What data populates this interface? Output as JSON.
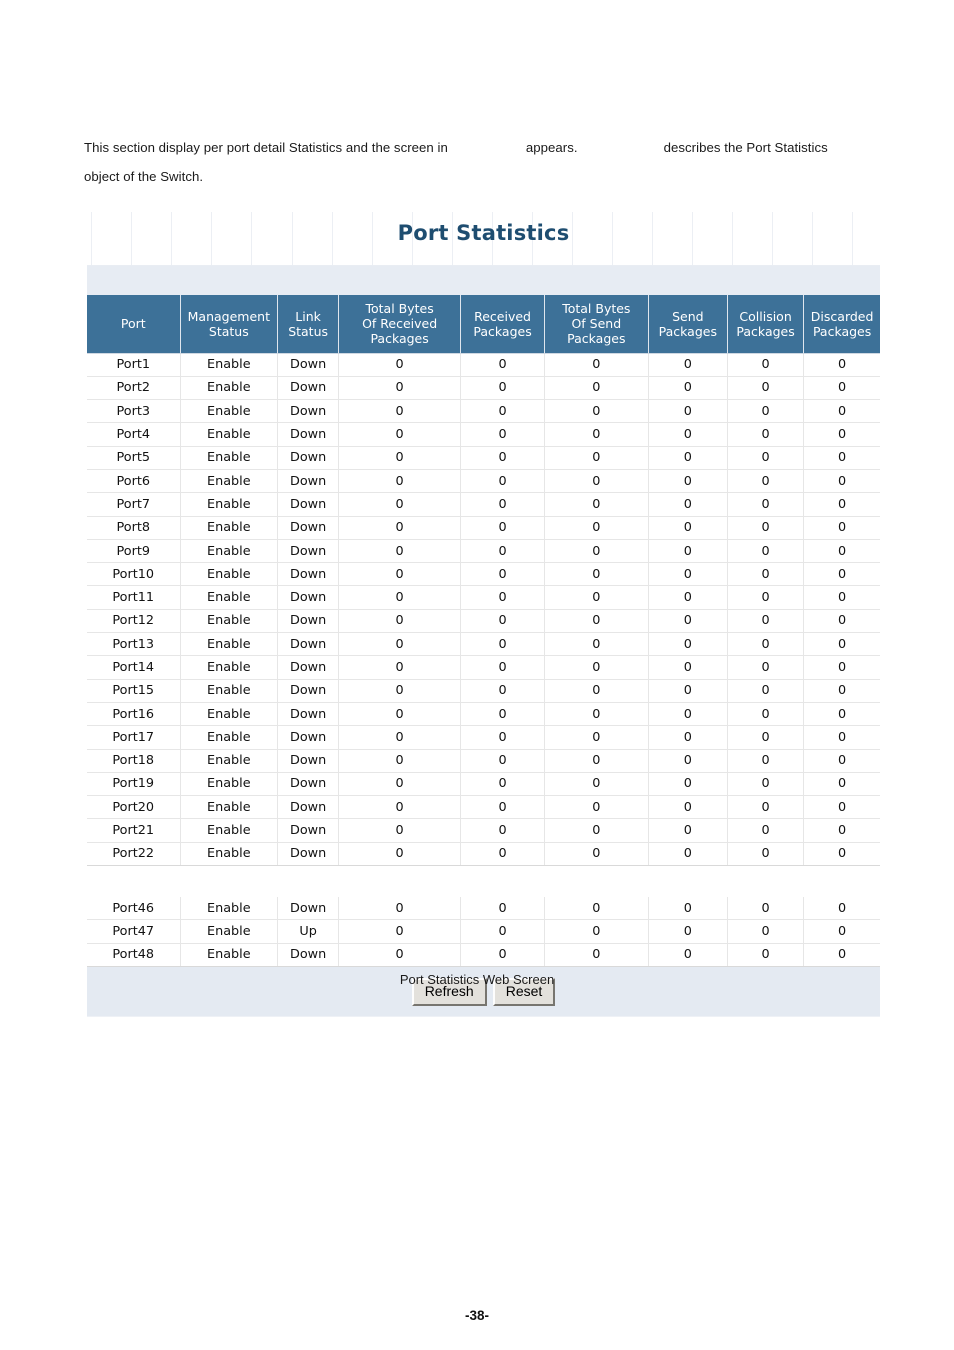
{
  "document": {
    "paragraph_part1": "This section display per port detail Statistics and the screen in",
    "paragraph_part2": "appears.",
    "paragraph_part3": "describes the Port Statistics",
    "paragraph_part4": "object of the Switch.",
    "figure_caption": "Port Statistics Web Screen",
    "page_number": "-38-"
  },
  "screenshot": {
    "title": "Port Statistics",
    "colors": {
      "header_bg": "#3d7198",
      "title_text": "#1e4d70",
      "band_bg": "#e7ecf3",
      "footer_bg": "#e4eaf2",
      "row_border": "#e6e6e6",
      "button_face": "#e3e1dc"
    },
    "columns": [
      "Port",
      "Management Status",
      "Link Status",
      "Total Bytes Of Received Packages",
      "Received Packages",
      "Total Bytes Of Send Packages",
      "Send Packages",
      "Collision Packages",
      "Discarded Packages"
    ],
    "columns_lines": [
      [
        "Port"
      ],
      [
        "Management",
        "Status"
      ],
      [
        "Link",
        "Status"
      ],
      [
        "Total Bytes",
        "Of Received",
        "Packages"
      ],
      [
        "Received",
        "Packages"
      ],
      [
        "Total Bytes",
        "Of Send",
        "Packages"
      ],
      [
        "Send",
        "Packages"
      ],
      [
        "Collision",
        "Packages"
      ],
      [
        "Discarded",
        "Packages"
      ]
    ],
    "rows_group1": [
      [
        "Port1",
        "Enable",
        "Down",
        "0",
        "0",
        "0",
        "0",
        "0",
        "0"
      ],
      [
        "Port2",
        "Enable",
        "Down",
        "0",
        "0",
        "0",
        "0",
        "0",
        "0"
      ],
      [
        "Port3",
        "Enable",
        "Down",
        "0",
        "0",
        "0",
        "0",
        "0",
        "0"
      ],
      [
        "Port4",
        "Enable",
        "Down",
        "0",
        "0",
        "0",
        "0",
        "0",
        "0"
      ],
      [
        "Port5",
        "Enable",
        "Down",
        "0",
        "0",
        "0",
        "0",
        "0",
        "0"
      ],
      [
        "Port6",
        "Enable",
        "Down",
        "0",
        "0",
        "0",
        "0",
        "0",
        "0"
      ],
      [
        "Port7",
        "Enable",
        "Down",
        "0",
        "0",
        "0",
        "0",
        "0",
        "0"
      ],
      [
        "Port8",
        "Enable",
        "Down",
        "0",
        "0",
        "0",
        "0",
        "0",
        "0"
      ],
      [
        "Port9",
        "Enable",
        "Down",
        "0",
        "0",
        "0",
        "0",
        "0",
        "0"
      ],
      [
        "Port10",
        "Enable",
        "Down",
        "0",
        "0",
        "0",
        "0",
        "0",
        "0"
      ],
      [
        "Port11",
        "Enable",
        "Down",
        "0",
        "0",
        "0",
        "0",
        "0",
        "0"
      ],
      [
        "Port12",
        "Enable",
        "Down",
        "0",
        "0",
        "0",
        "0",
        "0",
        "0"
      ],
      [
        "Port13",
        "Enable",
        "Down",
        "0",
        "0",
        "0",
        "0",
        "0",
        "0"
      ],
      [
        "Port14",
        "Enable",
        "Down",
        "0",
        "0",
        "0",
        "0",
        "0",
        "0"
      ],
      [
        "Port15",
        "Enable",
        "Down",
        "0",
        "0",
        "0",
        "0",
        "0",
        "0"
      ],
      [
        "Port16",
        "Enable",
        "Down",
        "0",
        "0",
        "0",
        "0",
        "0",
        "0"
      ],
      [
        "Port17",
        "Enable",
        "Down",
        "0",
        "0",
        "0",
        "0",
        "0",
        "0"
      ],
      [
        "Port18",
        "Enable",
        "Down",
        "0",
        "0",
        "0",
        "0",
        "0",
        "0"
      ],
      [
        "Port19",
        "Enable",
        "Down",
        "0",
        "0",
        "0",
        "0",
        "0",
        "0"
      ],
      [
        "Port20",
        "Enable",
        "Down",
        "0",
        "0",
        "0",
        "0",
        "0",
        "0"
      ],
      [
        "Port21",
        "Enable",
        "Down",
        "0",
        "0",
        "0",
        "0",
        "0",
        "0"
      ],
      [
        "Port22",
        "Enable",
        "Down",
        "0",
        "0",
        "0",
        "0",
        "0",
        "0"
      ]
    ],
    "rows_group2": [
      [
        "Port46",
        "Enable",
        "Down",
        "0",
        "0",
        "0",
        "0",
        "0",
        "0"
      ],
      [
        "Port47",
        "Enable",
        "Up",
        "0",
        "0",
        "0",
        "0",
        "0",
        "0"
      ],
      [
        "Port48",
        "Enable",
        "Down",
        "0",
        "0",
        "0",
        "0",
        "0",
        "0"
      ]
    ],
    "buttons": {
      "refresh": "Refresh",
      "reset": "Reset"
    }
  }
}
